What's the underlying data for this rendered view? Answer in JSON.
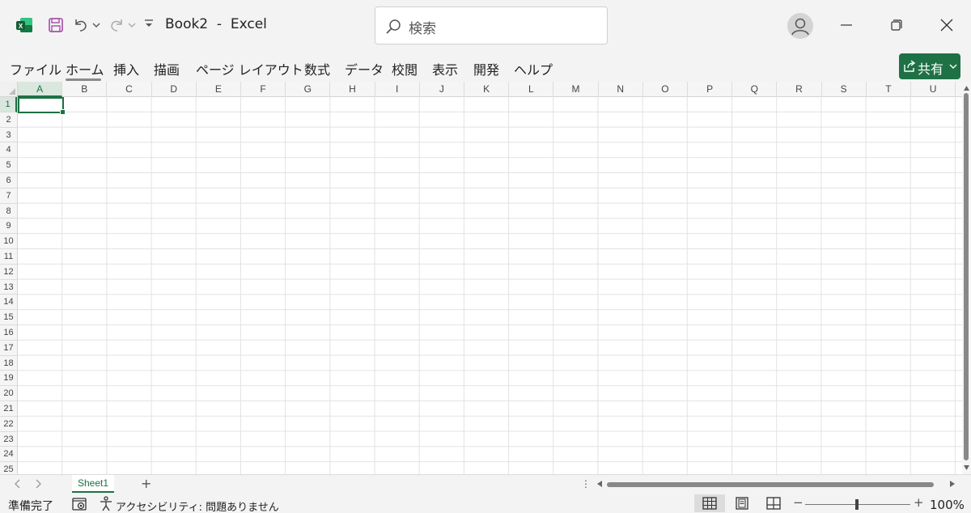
{
  "title_bar": {
    "doc_title": "Book2  -  Excel",
    "search_placeholder": "検索"
  },
  "ribbon": {
    "tabs": [
      "ファイル",
      "ホーム",
      "挿入",
      "描画",
      "ページ レイアウト",
      "数式",
      "データ",
      "校閲",
      "表示",
      "開発",
      "ヘルプ"
    ],
    "active_tab": "ホーム",
    "share_label": "共有"
  },
  "grid": {
    "columns": [
      "A",
      "B",
      "C",
      "D",
      "E",
      "F",
      "G",
      "H",
      "I",
      "J",
      "K",
      "L",
      "M",
      "N",
      "O",
      "P",
      "Q",
      "R",
      "S",
      "T",
      "U"
    ],
    "rows": [
      "1",
      "2",
      "3",
      "4",
      "5",
      "6",
      "7",
      "8",
      "9",
      "10",
      "11",
      "12",
      "13",
      "14",
      "15",
      "16",
      "17",
      "18",
      "19",
      "20",
      "21",
      "22",
      "23",
      "24",
      "25"
    ],
    "active_cell": "A1"
  },
  "sheets": {
    "tabs": [
      "Sheet1"
    ],
    "active": "Sheet1",
    "add_label": "+",
    "more_label": "⋮"
  },
  "status_bar": {
    "ready_text": "準備完了",
    "accessibility_text": "アクセシビリティ: 問題ありません",
    "zoom_minus": "−",
    "zoom_plus": "+",
    "zoom_level": "100%"
  },
  "colors": {
    "accent": "#1e7145",
    "share_button": "#1e7145",
    "save_icon": "#a64ca6"
  },
  "icons": [
    "excel-app-icon",
    "save-icon",
    "undo-icon",
    "redo-icon",
    "search-icon",
    "avatar-icon",
    "minimize-icon",
    "restore-icon",
    "close-icon",
    "share-icon",
    "macro-record-icon",
    "accessibility-icon",
    "normal-view-icon",
    "page-layout-view-icon",
    "page-break-view-icon"
  ]
}
